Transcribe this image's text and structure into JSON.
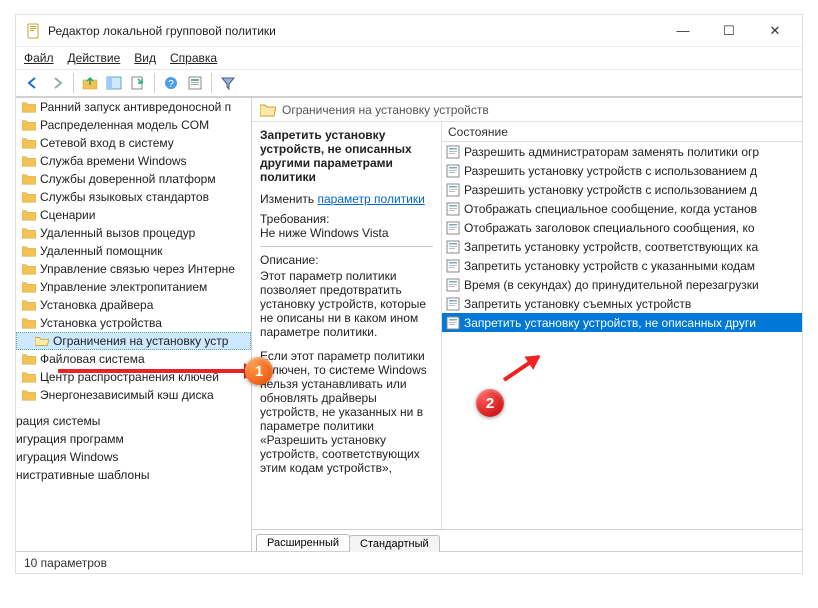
{
  "window": {
    "title": "Редактор локальной групповой политики"
  },
  "menu": {
    "file": "Файл",
    "action": "Действие",
    "view": "Вид",
    "help": "Справка"
  },
  "tree": {
    "items": [
      "Ранний запуск антивредоносной п",
      "Распределенная модель COM",
      "Сетевой вход в систему",
      "Служба времени Windows",
      "Службы доверенной платформ",
      "Службы языковых стандартов",
      "Сценарии",
      "Удаленный вызов процедур",
      "Удаленный помощник",
      "Управление связью через Интерне",
      "Управление электропитанием",
      "Установка драйвера",
      "Установка устройства",
      "Ограничения на установку устр",
      "Файловая система",
      "Центр распространения ключей",
      "Энергонезависимый кэш диска"
    ],
    "partial": [
      "рация системы",
      "игурация программ",
      "игурация Windows",
      "нистративные шаблоны"
    ],
    "selected_index": 13
  },
  "right": {
    "header": "Ограничения на установку устройств",
    "detail": {
      "title": "Запретить установку устройств, не описанных другими параметрами политики",
      "edit_label": "Изменить",
      "edit_link": "параметр политики",
      "req_label": "Требования:",
      "req_value": "Не ниже Windows Vista",
      "desc_label": "Описание:",
      "desc_p1": "Этот параметр политики позволяет предотвратить установку устройств, которые не описаны ни в каком ином параметре политики.",
      "desc_p2": "Если этот параметр политики включен, то системе Windows нельзя устанавливать или обновлять драйверы устройств, не указанных ни в параметре политики «Разрешить установку устройств, соответствующих этим кодам устройств»,"
    },
    "list_header": "Состояние",
    "list": [
      "Разрешить администраторам заменять политики огр",
      "Разрешить установку устройств с использованием д",
      "Разрешить установку устройств с использованием д",
      "Отображать специальное сообщение, когда установ",
      "Отображать заголовок специального сообщения, ко",
      "Запретить установку устройств, соответствующих ка",
      "Запретить установку устройств с указанными кодам",
      "Время (в секундах) до принудительной перезагрузки",
      "Запретить установку съемных устройств",
      "Запретить установку устройств, не описанных други"
    ],
    "selected_index": 9,
    "tabs": {
      "extended": "Расширенный",
      "standard": "Стандартный"
    }
  },
  "status": {
    "text": "10 параметров"
  }
}
